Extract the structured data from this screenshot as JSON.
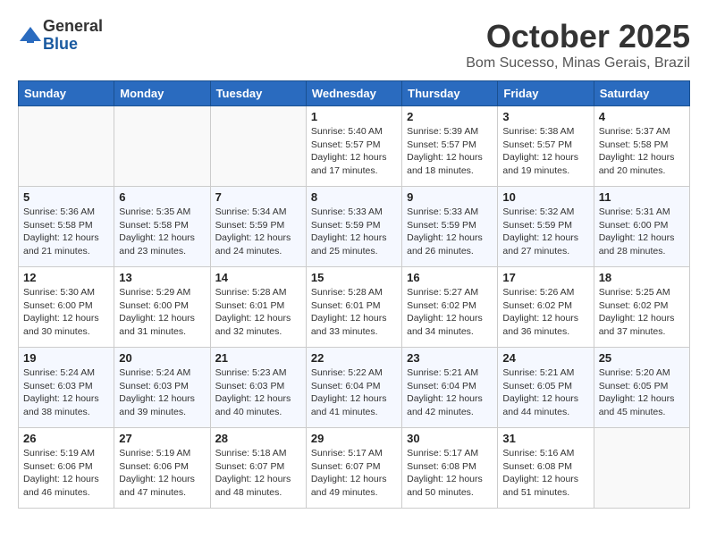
{
  "header": {
    "logo_general": "General",
    "logo_blue": "Blue",
    "month": "October 2025",
    "location": "Bom Sucesso, Minas Gerais, Brazil"
  },
  "weekdays": [
    "Sunday",
    "Monday",
    "Tuesday",
    "Wednesday",
    "Thursday",
    "Friday",
    "Saturday"
  ],
  "weeks": [
    [
      {
        "day": "",
        "sunrise": "",
        "sunset": "",
        "daylight": ""
      },
      {
        "day": "",
        "sunrise": "",
        "sunset": "",
        "daylight": ""
      },
      {
        "day": "",
        "sunrise": "",
        "sunset": "",
        "daylight": ""
      },
      {
        "day": "1",
        "sunrise": "Sunrise: 5:40 AM",
        "sunset": "Sunset: 5:57 PM",
        "daylight": "Daylight: 12 hours and 17 minutes."
      },
      {
        "day": "2",
        "sunrise": "Sunrise: 5:39 AM",
        "sunset": "Sunset: 5:57 PM",
        "daylight": "Daylight: 12 hours and 18 minutes."
      },
      {
        "day": "3",
        "sunrise": "Sunrise: 5:38 AM",
        "sunset": "Sunset: 5:57 PM",
        "daylight": "Daylight: 12 hours and 19 minutes."
      },
      {
        "day": "4",
        "sunrise": "Sunrise: 5:37 AM",
        "sunset": "Sunset: 5:58 PM",
        "daylight": "Daylight: 12 hours and 20 minutes."
      }
    ],
    [
      {
        "day": "5",
        "sunrise": "Sunrise: 5:36 AM",
        "sunset": "Sunset: 5:58 PM",
        "daylight": "Daylight: 12 hours and 21 minutes."
      },
      {
        "day": "6",
        "sunrise": "Sunrise: 5:35 AM",
        "sunset": "Sunset: 5:58 PM",
        "daylight": "Daylight: 12 hours and 23 minutes."
      },
      {
        "day": "7",
        "sunrise": "Sunrise: 5:34 AM",
        "sunset": "Sunset: 5:59 PM",
        "daylight": "Daylight: 12 hours and 24 minutes."
      },
      {
        "day": "8",
        "sunrise": "Sunrise: 5:33 AM",
        "sunset": "Sunset: 5:59 PM",
        "daylight": "Daylight: 12 hours and 25 minutes."
      },
      {
        "day": "9",
        "sunrise": "Sunrise: 5:33 AM",
        "sunset": "Sunset: 5:59 PM",
        "daylight": "Daylight: 12 hours and 26 minutes."
      },
      {
        "day": "10",
        "sunrise": "Sunrise: 5:32 AM",
        "sunset": "Sunset: 5:59 PM",
        "daylight": "Daylight: 12 hours and 27 minutes."
      },
      {
        "day": "11",
        "sunrise": "Sunrise: 5:31 AM",
        "sunset": "Sunset: 6:00 PM",
        "daylight": "Daylight: 12 hours and 28 minutes."
      }
    ],
    [
      {
        "day": "12",
        "sunrise": "Sunrise: 5:30 AM",
        "sunset": "Sunset: 6:00 PM",
        "daylight": "Daylight: 12 hours and 30 minutes."
      },
      {
        "day": "13",
        "sunrise": "Sunrise: 5:29 AM",
        "sunset": "Sunset: 6:00 PM",
        "daylight": "Daylight: 12 hours and 31 minutes."
      },
      {
        "day": "14",
        "sunrise": "Sunrise: 5:28 AM",
        "sunset": "Sunset: 6:01 PM",
        "daylight": "Daylight: 12 hours and 32 minutes."
      },
      {
        "day": "15",
        "sunrise": "Sunrise: 5:28 AM",
        "sunset": "Sunset: 6:01 PM",
        "daylight": "Daylight: 12 hours and 33 minutes."
      },
      {
        "day": "16",
        "sunrise": "Sunrise: 5:27 AM",
        "sunset": "Sunset: 6:02 PM",
        "daylight": "Daylight: 12 hours and 34 minutes."
      },
      {
        "day": "17",
        "sunrise": "Sunrise: 5:26 AM",
        "sunset": "Sunset: 6:02 PM",
        "daylight": "Daylight: 12 hours and 36 minutes."
      },
      {
        "day": "18",
        "sunrise": "Sunrise: 5:25 AM",
        "sunset": "Sunset: 6:02 PM",
        "daylight": "Daylight: 12 hours and 37 minutes."
      }
    ],
    [
      {
        "day": "19",
        "sunrise": "Sunrise: 5:24 AM",
        "sunset": "Sunset: 6:03 PM",
        "daylight": "Daylight: 12 hours and 38 minutes."
      },
      {
        "day": "20",
        "sunrise": "Sunrise: 5:24 AM",
        "sunset": "Sunset: 6:03 PM",
        "daylight": "Daylight: 12 hours and 39 minutes."
      },
      {
        "day": "21",
        "sunrise": "Sunrise: 5:23 AM",
        "sunset": "Sunset: 6:03 PM",
        "daylight": "Daylight: 12 hours and 40 minutes."
      },
      {
        "day": "22",
        "sunrise": "Sunrise: 5:22 AM",
        "sunset": "Sunset: 6:04 PM",
        "daylight": "Daylight: 12 hours and 41 minutes."
      },
      {
        "day": "23",
        "sunrise": "Sunrise: 5:21 AM",
        "sunset": "Sunset: 6:04 PM",
        "daylight": "Daylight: 12 hours and 42 minutes."
      },
      {
        "day": "24",
        "sunrise": "Sunrise: 5:21 AM",
        "sunset": "Sunset: 6:05 PM",
        "daylight": "Daylight: 12 hours and 44 minutes."
      },
      {
        "day": "25",
        "sunrise": "Sunrise: 5:20 AM",
        "sunset": "Sunset: 6:05 PM",
        "daylight": "Daylight: 12 hours and 45 minutes."
      }
    ],
    [
      {
        "day": "26",
        "sunrise": "Sunrise: 5:19 AM",
        "sunset": "Sunset: 6:06 PM",
        "daylight": "Daylight: 12 hours and 46 minutes."
      },
      {
        "day": "27",
        "sunrise": "Sunrise: 5:19 AM",
        "sunset": "Sunset: 6:06 PM",
        "daylight": "Daylight: 12 hours and 47 minutes."
      },
      {
        "day": "28",
        "sunrise": "Sunrise: 5:18 AM",
        "sunset": "Sunset: 6:07 PM",
        "daylight": "Daylight: 12 hours and 48 minutes."
      },
      {
        "day": "29",
        "sunrise": "Sunrise: 5:17 AM",
        "sunset": "Sunset: 6:07 PM",
        "daylight": "Daylight: 12 hours and 49 minutes."
      },
      {
        "day": "30",
        "sunrise": "Sunrise: 5:17 AM",
        "sunset": "Sunset: 6:08 PM",
        "daylight": "Daylight: 12 hours and 50 minutes."
      },
      {
        "day": "31",
        "sunrise": "Sunrise: 5:16 AM",
        "sunset": "Sunset: 6:08 PM",
        "daylight": "Daylight: 12 hours and 51 minutes."
      },
      {
        "day": "",
        "sunrise": "",
        "sunset": "",
        "daylight": ""
      }
    ]
  ]
}
